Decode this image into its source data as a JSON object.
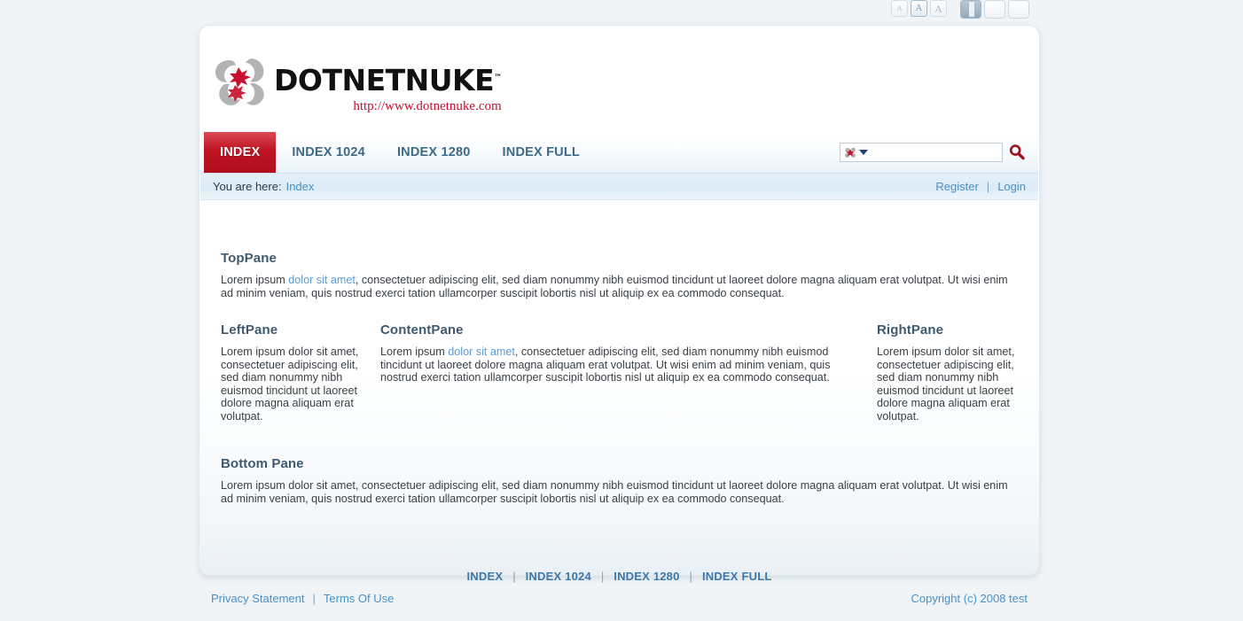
{
  "toolbar": {
    "font_small_label": "A",
    "font_medium_label": "A",
    "font_large_label": "A",
    "width_buttons": [
      "",
      "",
      ""
    ]
  },
  "header": {
    "logo_text": "DOTNETNUKE",
    "logo_tm": "™",
    "logo_url": "http://www.dotnetnuke.com"
  },
  "nav": {
    "items": [
      {
        "label": "INDEX",
        "active": true
      },
      {
        "label": "INDEX 1024",
        "active": false
      },
      {
        "label": "INDEX 1280",
        "active": false
      },
      {
        "label": "INDEX FULL",
        "active": false
      }
    ]
  },
  "search": {
    "value": "",
    "placeholder": "",
    "provider_icon": "dnn-icon",
    "dropdown_icon": "chevron-down-icon",
    "submit_icon": "search-icon"
  },
  "breadcrumb": {
    "prefix": "You are here:",
    "current": "Index",
    "register_label": "Register",
    "separator": "|",
    "login_label": "Login"
  },
  "panes": {
    "top": {
      "title": "TopPane",
      "text_before": "Lorem ipsum ",
      "link": "dolor sit amet",
      "text_after": ", consectetuer adipiscing elit, sed diam nonummy nibh euismod tincidunt ut laoreet dolore magna aliquam erat volutpat. Ut wisi enim ad minim veniam, quis nostrud exerci tation ullamcorper suscipit lobortis nisl ut aliquip ex ea commodo consequat."
    },
    "left": {
      "title": "LeftPane",
      "text": "Lorem ipsum dolor sit amet, consectetuer adipiscing elit, sed diam nonummy nibh euismod tincidunt ut laoreet dolore magna aliquam erat volutpat."
    },
    "content": {
      "title": "ContentPane",
      "text_before": "Lorem ipsum ",
      "link": "dolor sit amet",
      "text_after": ", consectetuer adipiscing elit, sed diam nonummy nibh euismod tincidunt ut laoreet dolore magna aliquam erat volutpat. Ut wisi enim ad minim veniam, quis nostrud exerci tation ullamcorper suscipit lobortis nisl ut aliquip ex ea commodo consequat."
    },
    "right": {
      "title": "RightPane",
      "text": "Lorem ipsum dolor sit amet, consectetuer adipiscing elit, sed diam nonummy nibh euismod tincidunt ut laoreet dolore magna aliquam erat volutpat."
    },
    "bottom": {
      "title": "Bottom Pane",
      "text": "Lorem ipsum dolor sit amet, consectetuer adipiscing elit, sed diam nonummy nibh euismod tincidunt ut laoreet dolore magna aliquam erat volutpat. Ut wisi enim ad minim veniam, quis nostrud exerci tation ullamcorper suscipit lobortis nisl ut aliquip ex ea commodo consequat."
    }
  },
  "footer_nav": {
    "items": [
      "INDEX",
      "INDEX 1024",
      "INDEX 1280",
      "INDEX FULL"
    ],
    "separator": "|"
  },
  "legal": {
    "privacy_label": "Privacy Statement",
    "separator": "|",
    "terms_label": "Terms Of Use",
    "copyright": "Copyright (c) 2008 test"
  },
  "colors": {
    "page_bg": "#f0f4f7",
    "accent_red": "#c01324",
    "link_blue": "#4a90c4",
    "nav_blue": "#3d6a88",
    "heading": "#3f5a70"
  }
}
